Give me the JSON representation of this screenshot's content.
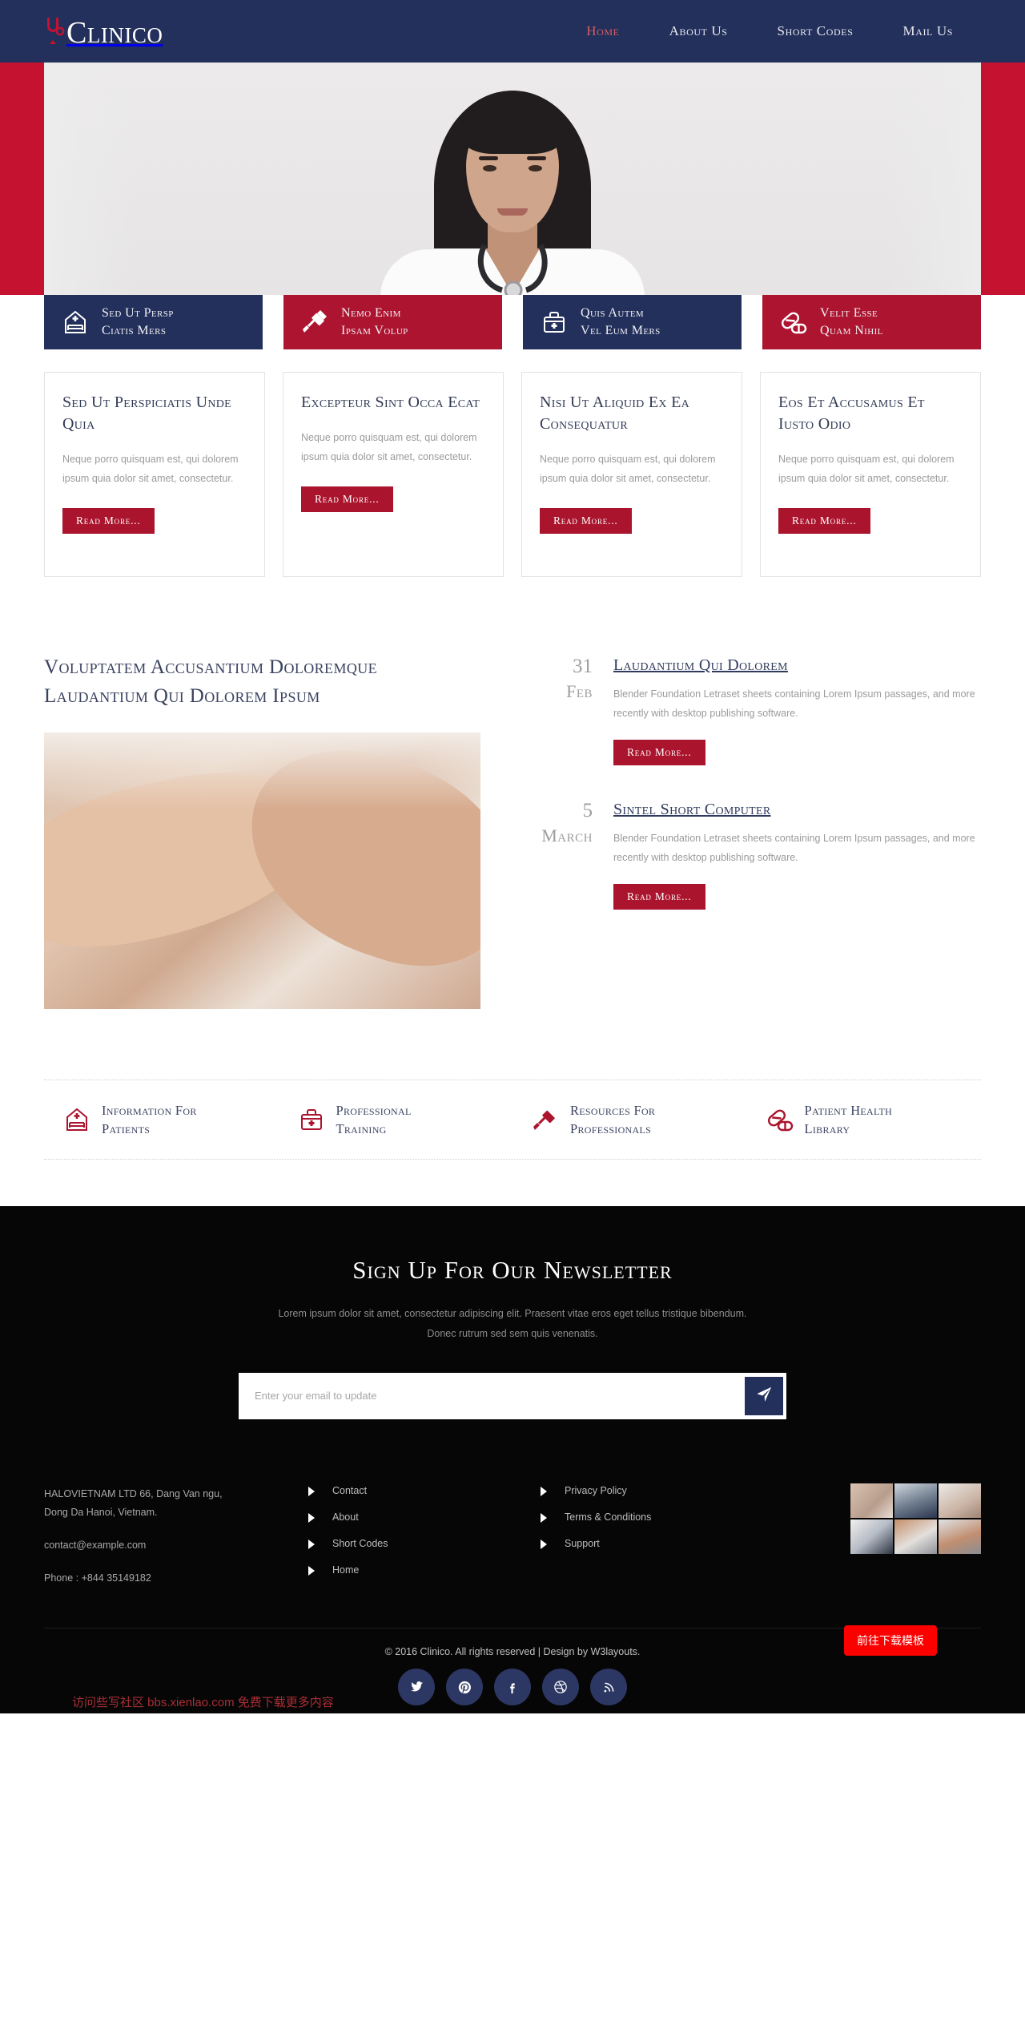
{
  "header": {
    "brand": "Clinico",
    "brand_icon": "stethoscope-icon",
    "nav": [
      {
        "label": "Home",
        "active": true
      },
      {
        "label": "About Us",
        "active": false
      },
      {
        "label": "Short Codes",
        "active": false
      },
      {
        "label": "Mail Us",
        "active": false
      }
    ]
  },
  "colors": {
    "navy": "#23305c",
    "red": "#ab142d",
    "banner_red": "#c41230",
    "nav_active": "#d45d63",
    "dark": "#060606",
    "social_circle": "#2d3763",
    "download_button": "#fc0000"
  },
  "banner": {
    "image_alt": "doctor-portrait"
  },
  "services": [
    {
      "icon": "hospital-bed-icon",
      "line1": "Sed Ut Persp",
      "line2": "Ciatis Mers",
      "theme": "navy"
    },
    {
      "icon": "syringe-icon",
      "line1": "Nemo Enim",
      "line2": "Ipsam Volup",
      "theme": "red"
    },
    {
      "icon": "medical-kit-icon",
      "line1": "Quis Autem",
      "line2": "Vel Eum Mers",
      "theme": "navy"
    },
    {
      "icon": "pills-icon",
      "line1": "Velit Esse",
      "line2": "Quam Nihil",
      "theme": "red"
    }
  ],
  "cards": [
    {
      "title": "Sed Ut Perspiciatis Unde Quia",
      "text": "Neque porro quisquam est, qui dolorem ipsum quia dolor sit amet, consectetur.",
      "button": "Read More..."
    },
    {
      "title": "Excepteur Sint Occa Ecat",
      "text": "Neque porro quisquam est, qui dolorem ipsum quia dolor sit amet, consectetur.",
      "button": "Read More..."
    },
    {
      "title": "Nisi Ut Aliquid Ex Ea Consequatur",
      "text": "Neque porro quisquam est, qui dolorem ipsum quia dolor sit amet, consectetur.",
      "button": "Read More..."
    },
    {
      "title": "Eos Et Accusamus Et Iusto Odio",
      "text": "Neque porro quisquam est, qui dolorem ipsum quia dolor sit amet, consectetur.",
      "button": "Read More..."
    }
  ],
  "about": {
    "heading": "Voluptatem Accusantium Doloremque Laudantium Qui Dolorem Ipsum",
    "image_alt": "hands-massage-therapy"
  },
  "posts": [
    {
      "day": "31",
      "month": "Feb",
      "title": "Laudantium Qui Dolorem",
      "text": "Blender Foundation Letraset sheets containing Lorem Ipsum passages, and more recently with desktop publishing software.",
      "button": "Read More..."
    },
    {
      "day": "5",
      "month": "March",
      "title": "Sintel Short Computer",
      "text": "Blender Foundation Letraset sheets containing Lorem Ipsum passages, and more recently with desktop publishing software.",
      "button": "Read More..."
    }
  ],
  "quicklinks": [
    {
      "icon": "hospital-bed-icon",
      "line1": "Information For",
      "line2": "Patients"
    },
    {
      "icon": "medical-kit-icon",
      "line1": "Professional",
      "line2": "Training"
    },
    {
      "icon": "syringe-icon",
      "line1": "Resources For",
      "line2": "Professionals"
    },
    {
      "icon": "pills-icon",
      "line1": "Patient Health",
      "line2": "Library"
    }
  ],
  "newsletter": {
    "heading": "Sign Up For Our Newsletter",
    "text": "Lorem ipsum dolor sit amet, consectetur adipiscing elit. Praesent vitae eros eget tellus tristique bibendum. Donec rutrum sed sem quis venenatis.",
    "placeholder": "Enter your email to update",
    "submit_icon": "paper-plane-icon"
  },
  "footer": {
    "address_line1": "HALOVIETNAM LTD 66, Dang Van ngu,",
    "address_line2": "Dong Da Hanoi, Vietnam.",
    "email": "contact@example.com",
    "phone": "Phone : +844 35149182",
    "links_col1": [
      "Contact",
      "About",
      "Short Codes",
      "Home"
    ],
    "links_col2": [
      "Privacy Policy",
      "Terms & Conditions",
      "Support"
    ],
    "gallery_alt": [
      "massage-hands",
      "operating-room",
      "surgeons",
      "blood-pressure-kit",
      "ct-scanner",
      "lab-test"
    ],
    "copyright": "© 2016 Clinico. All rights reserved | Design by W3layouts.",
    "social": [
      "twitter-icon",
      "pinterest-icon",
      "facebook-icon",
      "dribbble-icon",
      "rss-icon"
    ],
    "download_button": "前往下载模板",
    "watermark": "访问些写社区 bbs.xienlao.com 免费下载更多内容"
  }
}
